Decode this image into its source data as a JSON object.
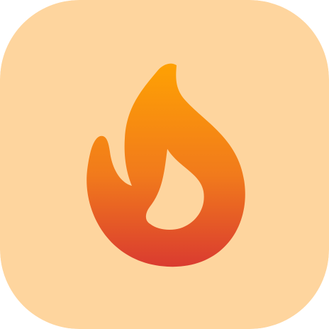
{
  "icon": {
    "name": "flame-icon",
    "tile_color": "#FED59E",
    "flame_gradient": {
      "top": "#FEA103",
      "middle": "#F17A1C",
      "bottom": "#DA3B30"
    },
    "inner_color": "#FED59E"
  }
}
